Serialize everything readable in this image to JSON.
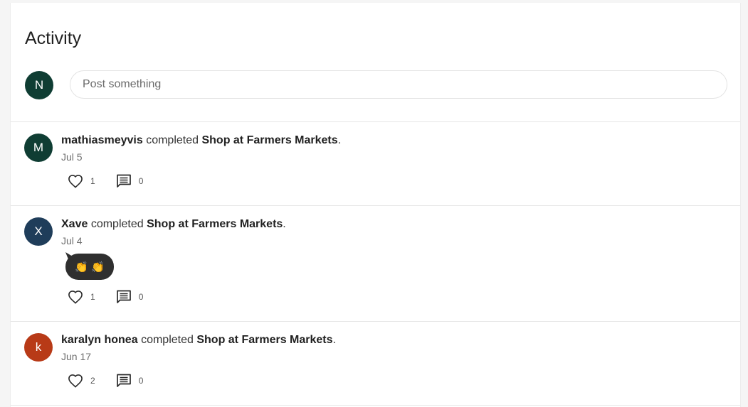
{
  "page": {
    "title": "Activity"
  },
  "composer": {
    "avatar_initial": "N",
    "avatar_color": "#0f3d33",
    "placeholder": "Post something"
  },
  "feed": [
    {
      "avatar_initial": "M",
      "avatar_color": "#0f3d33",
      "user": "mathiasmeyvis",
      "verb": "completed",
      "challenge": "Shop at Farmers Markets",
      "period": ".",
      "date": "Jul 5",
      "likes": "1",
      "comments": "0"
    },
    {
      "avatar_initial": "X",
      "avatar_color": "#1f3d5a",
      "user": "Xave",
      "verb": "completed",
      "challenge": "Shop at Farmers Markets",
      "period": ".",
      "date": "Jul 4",
      "reaction": "👏 👏",
      "likes": "1",
      "comments": "0"
    },
    {
      "avatar_initial": "k",
      "avatar_color": "#b83a17",
      "user": "karalyn honea",
      "verb": "completed",
      "challenge": "Shop at Farmers Markets",
      "period": ".",
      "date": "Jun 17",
      "likes": "2",
      "comments": "0"
    }
  ],
  "icons": {
    "like": "heart-outline-icon",
    "comment": "comment-icon"
  }
}
